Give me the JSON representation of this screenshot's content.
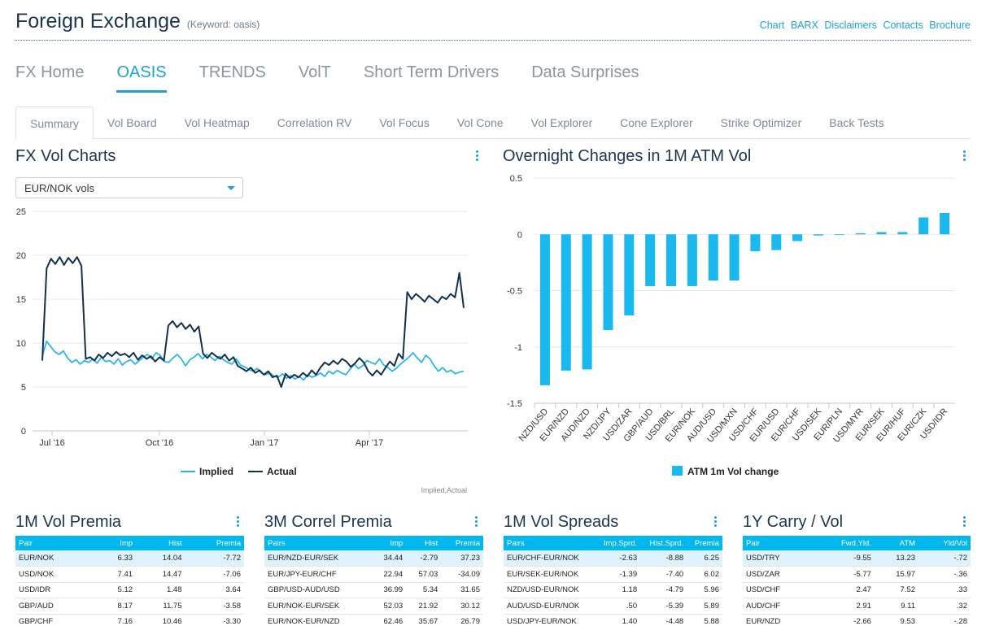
{
  "header": {
    "title": "Foreign Exchange",
    "keyword": "(Keyword: oasis)",
    "links": [
      "Chart",
      "BARX",
      "Disclaimers",
      "Contacts",
      "Brochure"
    ]
  },
  "mainnav": [
    "FX Home",
    "OASIS",
    "TRENDS",
    "VolT",
    "Short Term Drivers",
    "Data Surprises"
  ],
  "subtabs": [
    "Summary",
    "Vol Board",
    "Vol Heatmap",
    "Correlation RV",
    "Vol Focus",
    "Vol Cone",
    "Vol Explorer",
    "Cone Explorer",
    "Strike Optimizer",
    "Back Tests"
  ],
  "fxvol": {
    "title": "FX Vol Charts",
    "dropdown": "EUR/NOK vols"
  },
  "overnight": {
    "title": "Overnight Changes in 1M ATM Vol"
  },
  "colors": {
    "accent": "#1aa3d8",
    "implied": "#29b6f0",
    "actual": "#14304f",
    "bar": "#19b8ef",
    "header_bg": "#00b7ee"
  },
  "chart_data": [
    {
      "type": "line",
      "xlabel": "",
      "ylabel": "",
      "ylim": [
        0,
        25
      ],
      "yticks": [
        "0",
        "5",
        "10",
        "15",
        "20",
        "25"
      ],
      "xticks": [
        "Jul '16",
        "Oct '16",
        "Jan '17",
        "Apr '17"
      ],
      "grid": true,
      "legend": "bottom",
      "credit": "Implied,Actual",
      "series": [
        {
          "name": "Implied",
          "values": [
            8.5,
            10.2,
            9.6,
            9.0,
            8.7,
            9.1,
            8.3,
            7.8,
            8.1,
            7.6,
            8.0,
            7.8,
            8.2,
            7.7,
            8.4,
            7.9,
            8.0,
            7.6,
            8.2,
            7.5,
            7.9,
            8.1,
            7.6,
            8.0,
            8.4,
            8.7,
            8.2,
            8.9,
            8.6,
            7.9,
            7.8,
            8.3,
            8.7,
            8.2,
            7.4,
            8.1,
            8.4,
            8.8,
            8.2,
            8.7,
            8.4,
            8.0,
            8.5,
            8.1,
            7.8,
            7.6,
            8.2,
            7.5,
            7.3,
            7.0,
            6.8,
            7.1,
            6.6,
            6.4,
            6.6,
            6.2,
            6.1,
            6.5,
            6.0,
            6.3,
            5.9,
            6.2,
            5.8,
            6.4,
            6.1,
            6.3,
            6.6,
            6.2,
            6.8,
            6.5,
            6.9,
            6.6,
            6.4,
            7.0,
            7.6,
            7.1,
            7.4,
            8.0,
            7.8,
            7.6,
            8.2,
            7.5,
            7.2,
            6.8,
            7.1,
            7.6,
            8.0,
            8.4,
            8.9,
            8.3,
            7.8,
            8.6,
            8.2,
            7.4,
            6.8,
            7.2,
            6.7,
            6.9,
            6.5,
            6.7,
            6.8
          ]
        },
        {
          "name": "Actual",
          "values": [
            8.0,
            18.5,
            19.6,
            19.0,
            19.8,
            18.9,
            19.7,
            19.1,
            19.8,
            18.8,
            8.2,
            8.4,
            8.0,
            8.7,
            8.3,
            8.9,
            8.5,
            9.0,
            8.6,
            8.8,
            8.4,
            8.9,
            8.1,
            8.6,
            8.2,
            8.5,
            7.9,
            8.4,
            8.0,
            12.0,
            12.5,
            11.8,
            12.3,
            11.6,
            12.1,
            11.3,
            11.9,
            8.8,
            8.3,
            8.9,
            8.5,
            8.2,
            8.7,
            8.0,
            8.4,
            7.4,
            7.1,
            6.8,
            7.2,
            6.6,
            6.9,
            6.4,
            6.8,
            6.1,
            6.3,
            5.0,
            6.5,
            6.0,
            6.4,
            6.1,
            6.6,
            6.2,
            6.9,
            6.4,
            7.2,
            7.8,
            7.5,
            8.0,
            7.6,
            8.2,
            7.9,
            7.3,
            7.7,
            8.3,
            7.8,
            6.8,
            6.3,
            6.9,
            6.4,
            7.2,
            7.9,
            7.4,
            8.8,
            8.2,
            15.8,
            15.0,
            15.6,
            15.2,
            14.7,
            15.4,
            15.0,
            14.6,
            15.3,
            15.0,
            15.6,
            15.2,
            18.0,
            14.0
          ]
        }
      ]
    },
    {
      "type": "bar",
      "categories": [
        "NZD/USD",
        "EUR/NZD",
        "AUD/NZD",
        "NZD/JPY",
        "USD/ZAR",
        "GBP/AUD",
        "USD/BRL",
        "EUR/NOK",
        "AUD/USD",
        "USD/MXN",
        "USD/CHF",
        "EUR/USD",
        "EUR/CHF",
        "USD/SEK",
        "EUR/PLN",
        "USD/MYR",
        "EUR/SEK",
        "EUR/HUF",
        "EUR/CZK",
        "USD/IDR"
      ],
      "values": [
        -1.34,
        -1.21,
        -1.2,
        -0.85,
        -0.72,
        -0.46,
        -0.46,
        -0.46,
        -0.41,
        -0.41,
        -0.15,
        -0.14,
        -0.06,
        -0.01,
        0.0,
        0.01,
        0.02,
        0.02,
        0.15,
        0.19
      ],
      "ylim": [
        -1.5,
        0.5
      ],
      "yticks": [
        "-1.5",
        "-1",
        "-0.5",
        "0",
        "0.5"
      ],
      "grid": true,
      "legend": "bottom",
      "series": [
        {
          "name": "ATM 1m Vol change"
        }
      ]
    }
  ],
  "tables": [
    {
      "title": "1M Vol Premia",
      "headers": [
        "Pair",
        "Imp",
        "Hist",
        "Premia"
      ],
      "rows": [
        [
          "EUR/NOK",
          "6.33",
          "14.04",
          "-7.72"
        ],
        [
          "USD/NOK",
          "7.41",
          "14.47",
          "-7.06"
        ],
        [
          "USD/IDR",
          "5.12",
          "1.48",
          "3.64"
        ],
        [
          "GBP/AUD",
          "8.17",
          "11.75",
          "-3.58"
        ],
        [
          "GBP/CHF",
          "7.16",
          "10.46",
          "-3.30"
        ]
      ]
    },
    {
      "title": "3M Correl Premia",
      "headers": [
        "Pairs",
        "Imp",
        "Hist",
        "Premia"
      ],
      "rows": [
        [
          "EUR/NZD-EUR/SEK",
          "34.44",
          "-2.79",
          "37.23"
        ],
        [
          "EUR/JPY-EUR/CHF",
          "22.94",
          "57.03",
          "-34.09"
        ],
        [
          "GBP/USD-AUD/USD",
          "36.99",
          "5.34",
          "31.65"
        ],
        [
          "EUR/NOK-EUR/SEK",
          "52.03",
          "21.92",
          "30.12"
        ],
        [
          "EUR/NOK-EUR/NZD",
          "62.46",
          "35.67",
          "26.79"
        ]
      ]
    },
    {
      "title": "1M Vol Spreads",
      "headers": [
        "Pairs",
        "Imp.Sprd.",
        "Hist.Sprd.",
        "Premia"
      ],
      "rows": [
        [
          "EUR/CHF-EUR/NOK",
          "-2.63",
          "-8.88",
          "6.25"
        ],
        [
          "EUR/SEK-EUR/NOK",
          "-1.39",
          "-7.40",
          "6.02"
        ],
        [
          "NZD/USD-EUR/NOK",
          "1.18",
          "-4.79",
          "5.96"
        ],
        [
          "AUD/USD-EUR/NOK",
          ".50",
          "-5.39",
          "5.89"
        ],
        [
          "USD/JPY-EUR/NOK",
          "1.40",
          "-4.48",
          "5.88"
        ]
      ]
    },
    {
      "title": "1Y Carry / Vol",
      "headers": [
        "Pair",
        "Fwd.Yld.",
        "ATM",
        "Yld/Vol"
      ],
      "rows": [
        [
          "USD/TRY",
          "-9.55",
          "13.23",
          "-.72"
        ],
        [
          "USD/ZAR",
          "-5.77",
          "15.97",
          "-.36"
        ],
        [
          "USD/CHF",
          "2.47",
          "7.52",
          ".33"
        ],
        [
          "AUD/CHF",
          "2.91",
          "9.11",
          ".32"
        ],
        [
          "EUR/NZD",
          "-2.66",
          "9.53",
          "-.28"
        ]
      ]
    }
  ]
}
